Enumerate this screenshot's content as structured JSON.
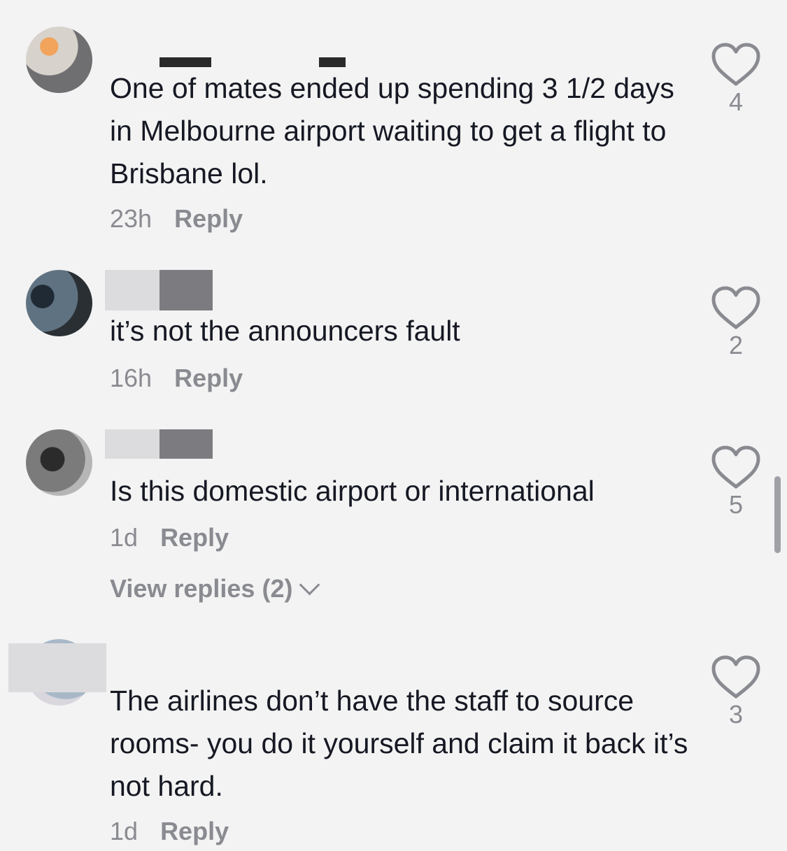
{
  "comments": [
    {
      "text": "One of mates ended up spending 3 1/2 days in Melbourne airport waiting to get a flight to Brisbane lol.",
      "time": "23h",
      "reply_label": "Reply",
      "likes": "4"
    },
    {
      "text": "it’s not the announcers fault",
      "time": "16h",
      "reply_label": "Reply",
      "likes": "2"
    },
    {
      "text": "Is this domestic airport or international",
      "time": "1d",
      "reply_label": "Reply",
      "likes": "5",
      "view_replies": "View replies (2)"
    },
    {
      "text": "The airlines don’t have the staff to source rooms- you do it yourself and claim it back it’s not hard.",
      "time": "1d",
      "reply_label": "Reply",
      "likes": "3"
    }
  ],
  "icons": {
    "like": "heart-outline-icon",
    "expand": "chevron-down-icon"
  },
  "colors": {
    "background": "#f3f3f3",
    "text": "#161823",
    "secondary": "#8a8b91"
  }
}
